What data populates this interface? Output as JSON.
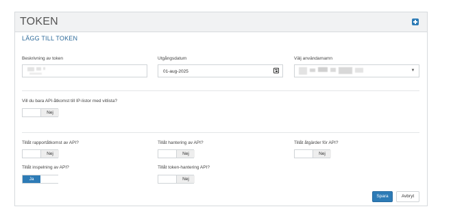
{
  "panel": {
    "title": "TOKEN",
    "add_icon": "plus-square-icon"
  },
  "form": {
    "heading": "LÄGG TILL TOKEN",
    "description": {
      "label": "Beskrivning av token",
      "value": ""
    },
    "expiry": {
      "label": "Utgångsdatum",
      "value": "01-aug-2025",
      "icon": "calendar-icon"
    },
    "username": {
      "label": "Välj användarnamn",
      "value": "",
      "icon": "caret-down-icon"
    },
    "ip_only": {
      "label": "Vill du bara API-åtkomst till IP-listor med vitlista?",
      "state": "Nej"
    },
    "report_access": {
      "label": "Tillåt rapportåtkomst av API?",
      "state": "Nej"
    },
    "management": {
      "label": "Tillåt hantering av API?",
      "state": "Nej"
    },
    "actions": {
      "label": "Tillåt åtgärder för API?",
      "state": "Nej"
    },
    "recording": {
      "label": "Tillåt inspelning av API?",
      "state": "Ja"
    },
    "token_management": {
      "label": "Tillåt token-hantering API?",
      "state": "Nej"
    }
  },
  "buttons": {
    "save": "Spara",
    "cancel": "Avbryt"
  },
  "colors": {
    "accent": "#2d7bb6",
    "heading": "#2d6a9a"
  }
}
